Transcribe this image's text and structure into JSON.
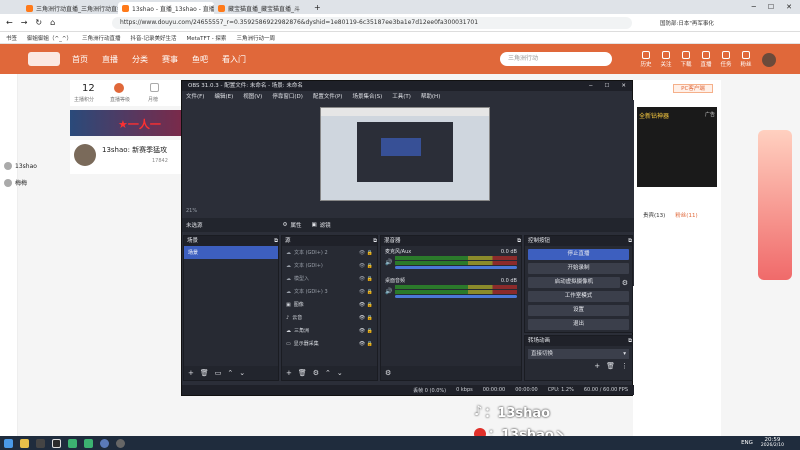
{
  "browser": {
    "tabs": [
      {
        "label": "三角洲行动直播_三角洲行动直播"
      },
      {
        "label": "13shao - 直播_13shao - 直播"
      },
      {
        "label": "藏宝猫直播_藏宝猫直播_斗"
      }
    ],
    "url": "https://www.douyu.com/24655557_r=0.3592586922982876&dyshid=1e80119-6c35187ee3ba1e7d12ee0fa300031701",
    "extension_text": "国防部:日本\"再军事化",
    "bookmarks": [
      "书签",
      "御姐御姐（^_^）",
      "三角洲行动直播",
      "抖音-记录美好生活",
      "MetaTFT - 探索",
      "三角洲行动一周"
    ]
  },
  "douyu": {
    "nav": [
      "首页",
      "直播",
      "分类",
      "赛事",
      "鱼吧",
      "看入门"
    ],
    "search_placeholder": "三角洲行动",
    "header_icons": [
      "历史",
      "关注",
      "下载",
      "直播",
      "任务",
      "粉丝"
    ],
    "anchor_name": "13shao: 新赛季猛攻",
    "stats": {
      "level": "12",
      "label1": "主播积分",
      "label2": "直播等级",
      "label3": "月榜"
    },
    "fans": "17842",
    "viewers": [
      {
        "name": "13shao"
      },
      {
        "name": "梅梅"
      }
    ],
    "banner_text": "★一人一",
    "right_panel": {
      "pc_client": "PC客户端",
      "ad_label": "广告",
      "tabs": [
        "贵宾(13)",
        "粉丝(11)"
      ],
      "promo": "全新钻神器"
    }
  },
  "obs": {
    "title": "OBS 31.0.3 - 配置文件: 未命名 - 场景: 未命名",
    "menu": [
      "文件(F)",
      "编辑(E)",
      "视图(V)",
      "停靠窗口(D)",
      "配置文件(P)",
      "场景集合(S)",
      "工具(T)",
      "帮助(H)"
    ],
    "preview_zoom": "21%",
    "no_source": "未选源",
    "properties": "属性",
    "filters": "滤镜",
    "docks": {
      "scenes": {
        "title": "场景",
        "items": [
          "场景"
        ]
      },
      "sources": {
        "title": "源",
        "items": [
          "文本 (GDI+) 2",
          "文本 (GDI+)",
          "模型入",
          "文本 (GDI+) 3",
          "图像",
          "云音",
          "三角洲",
          "显示器采集"
        ]
      },
      "mixer": {
        "title": "混音器",
        "channels": [
          {
            "name": "麦克风/Aux",
            "db": "0.0 dB"
          },
          {
            "name": "桌面音频",
            "db": "0.0 dB"
          }
        ]
      },
      "controls": {
        "title": "控制按钮",
        "buttons": [
          "停止直播",
          "开始录制",
          "启动虚拟摄像机",
          "工作室模式",
          "设置",
          "退出"
        ]
      },
      "transitions": {
        "title": "转场动画",
        "value": "直接切换"
      }
    },
    "status": {
      "dropped": "丢帧 0 (0.0%)",
      "kbps": "0 kbps",
      "live_time": "00:00:00",
      "rec_time": "00:00:00",
      "cpu": "CPU: 1.2%",
      "fps": "60.00 / 60.00 FPS"
    }
  },
  "overlay": {
    "line1": "：13shao",
    "line2": "：13shao丶"
  },
  "taskbar": {
    "lang": "ENG",
    "time": "20:59",
    "date": "2026/2/10"
  },
  "colors": {
    "douyu_orange": "#e0683a",
    "obs_bg": "#2b2e38",
    "obs_blue": "#3d5fbf"
  }
}
